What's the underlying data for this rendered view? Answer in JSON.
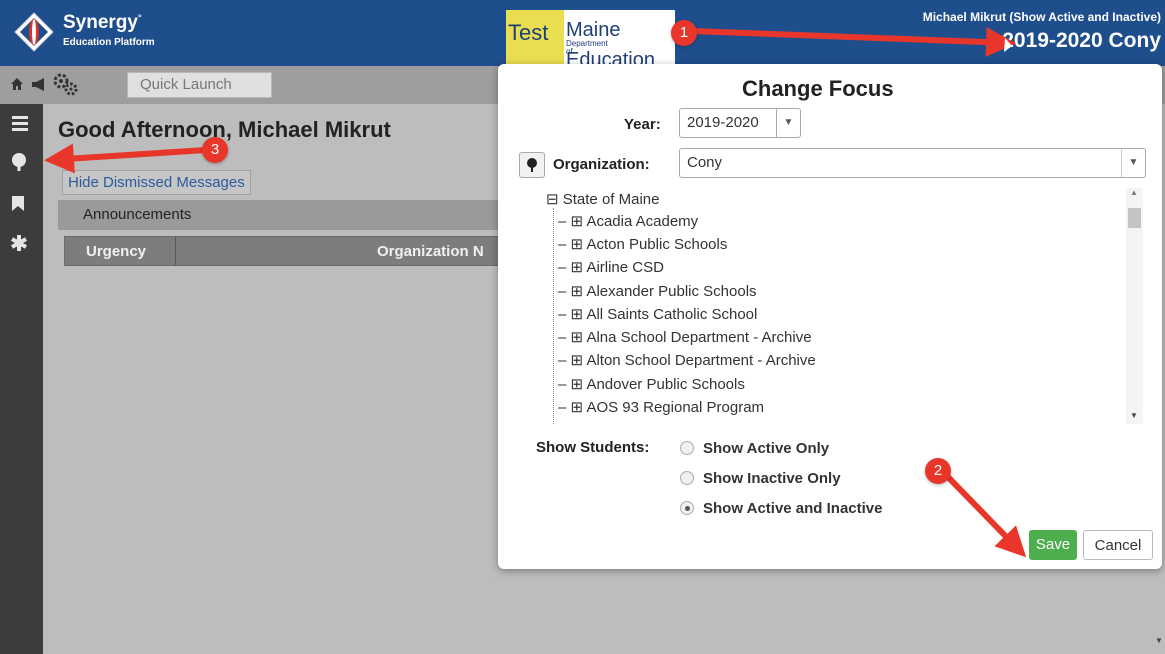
{
  "header": {
    "logo_name": "Synergy",
    "logo_trademark": "°",
    "logo_tagline": "Education Platform",
    "brand_test": "Test",
    "brand_maine": "Maine",
    "brand_dept": "Department of",
    "brand_education": "Education",
    "user": "Michael Mikrut (Show Active and Inactive)",
    "focus": "2019-2020 Cony"
  },
  "toolbar": {
    "home_icon": "home-icon",
    "announce_icon": "megaphone-icon",
    "settings_icon": "gears-icon",
    "quick_launch_placeholder": "Quick Launch"
  },
  "rail": {
    "icons": [
      "menu-icon",
      "tree-icon",
      "bookmark-icon",
      "asterisk-icon"
    ]
  },
  "main": {
    "greeting": "Good Afternoon, Michael Mikrut",
    "hide_dismissed": "Hide Dismissed Messages",
    "announcements": "Announcements",
    "columns": [
      "Urgency",
      "Organization N"
    ]
  },
  "dialog": {
    "title": "Change Focus",
    "year_label": "Year:",
    "year_value": "2019-2020",
    "org_label": "Organization:",
    "org_value": "Cony",
    "tree_root": "State of Maine",
    "tree_items": [
      "Acadia Academy",
      "Acton Public Schools",
      "Airline CSD",
      "Alexander Public Schools",
      "All Saints Catholic School",
      "Alna School Department - Archive",
      "Alton School Department - Archive",
      "Andover Public Schools",
      "AOS 93 Regional Program"
    ],
    "show_students_label": "Show Students:",
    "options": [
      "Show Active Only",
      "Show Inactive Only",
      "Show Active and Inactive"
    ],
    "selected_option": "Show Active and Inactive",
    "save": "Save",
    "cancel": "Cancel"
  },
  "annotations": {
    "badges": [
      "1",
      "2",
      "3"
    ],
    "color": "#e8362a"
  }
}
